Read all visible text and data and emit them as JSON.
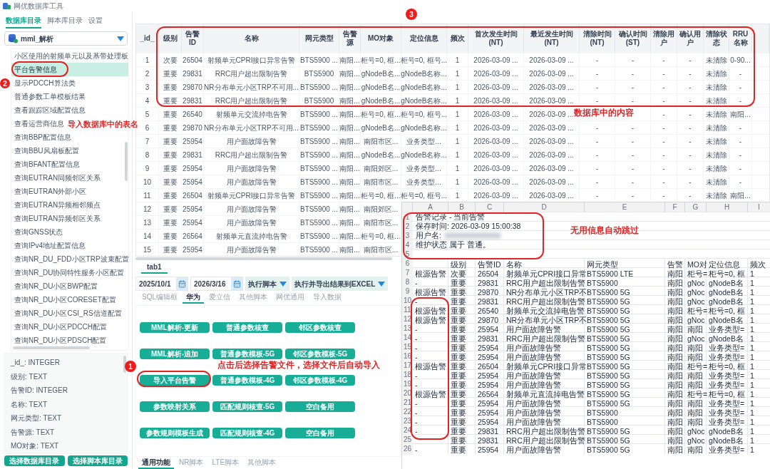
{
  "window": {
    "title": "网优数据库工具"
  },
  "sidebar": {
    "tabs": [
      {
        "label": "数据库目录",
        "selected": true
      },
      {
        "label": "脚本库目录",
        "selected": false
      },
      {
        "label": "设置",
        "selected": false
      }
    ],
    "database": "mml_解析",
    "tables": [
      {
        "label": "小区使用的射频单元以及基带处理板",
        "selected": false
      },
      {
        "label": "平台告警信息",
        "selected": true
      },
      {
        "label": "显示PDCCH算法类",
        "selected": false
      },
      {
        "label": "普通参数工单模板结果",
        "selected": false
      },
      {
        "label": "查看跟踪区域配置信息",
        "selected": false
      },
      {
        "label": "查看运营商信息",
        "selected": false
      },
      {
        "label": "查询BBP配置信息",
        "selected": false
      },
      {
        "label": "查询BBU风扇板配置",
        "selected": false
      },
      {
        "label": "查询BFANT配置信息",
        "selected": false
      },
      {
        "label": "查询EUTRAN同频邻区关系",
        "selected": false
      },
      {
        "label": "查询EUTRAN外部小区",
        "selected": false
      },
      {
        "label": "查询EUTRAN异频相邻频点",
        "selected": false
      },
      {
        "label": "查询EUTRAN异频邻区关系",
        "selected": false
      },
      {
        "label": "查询GNSS状态",
        "selected": false
      },
      {
        "label": "查询IPv4地址配置信息",
        "selected": false
      },
      {
        "label": "查询NR_DU_FDD小区TRP波束配置",
        "selected": false
      },
      {
        "label": "查询NR_DU协同特性服务小区配置",
        "selected": false
      },
      {
        "label": "查询NR_DU小区BWP配置",
        "selected": false
      },
      {
        "label": "查询NR_DU小区CORESET配置",
        "selected": false
      },
      {
        "label": "查询NR_DU小区CSI_RS信道配置",
        "selected": false
      },
      {
        "label": "查询NR_DU小区PDCCH配置",
        "selected": false
      },
      {
        "label": "查询NR_DU小区PDSCH配置",
        "selected": false
      }
    ],
    "fields": [
      "_id_: INTEGER",
      "级别: TEXT",
      "告警ID: INTEGER",
      "名称: TEXT",
      "网元类型: TEXT",
      "告警源: TEXT",
      "MO对象: TEXT"
    ],
    "buttons": [
      "选择数据库目录",
      "选择脚本库目录"
    ]
  },
  "table": {
    "columns": [
      "_id_",
      "级别",
      "告警ID",
      "名称",
      "网元类型",
      "告警源",
      "MO对象",
      "定位信息",
      "频次",
      "首次发生时间 (NT)",
      "最近发生时间 (NT)",
      "清除时间 (NT)",
      "确认时间 (ST)",
      "清除用户",
      "确认用户",
      "清除状态",
      "RRU名称"
    ],
    "rows": [
      [
        "1",
        "次要",
        "26504",
        "射频单元CPRI接口异常告警",
        "BTS5900 ...",
        "南阳...",
        "柜号=0, 框...",
        "柜号=0, 框号...",
        "1",
        "2026-03-09 ...",
        "2026-03-09 ...",
        "-",
        "-",
        "-",
        "-",
        "未清除",
        "0-90..."
      ],
      [
        "2",
        "重要",
        "29831",
        "RRC用户超出限制告警",
        "BTS5900",
        "南阳...",
        "gNodeB名...",
        "gNodeB名称...",
        "1",
        "2026-03-09 ...",
        "2026-03-09 ...",
        "-",
        "-",
        "-",
        "-",
        "未清除",
        "-"
      ],
      [
        "3",
        "重要",
        "29870",
        "NR分布单元小区TRP不可用...",
        "BTS5900 ...",
        "南阳...",
        "gNodeB名...",
        "gNodeB名称...",
        "1",
        "2026-03-09 ...",
        "2026-03-09 ...",
        "-",
        "-",
        "-",
        "-",
        "未清除",
        "-"
      ],
      [
        "4",
        "重要",
        "29831",
        "RRC用户超出限制告警",
        "BTS5900",
        "南阳...",
        "gNodeB名...",
        "gNodeB名称...",
        "1",
        "2026-03-09 ...",
        "2026-03-09 ...",
        "-",
        "-",
        "-",
        "-",
        "未清除",
        "-"
      ],
      [
        "5",
        "重要",
        "26540",
        "射频单元交流掉电告警",
        "BTS5900 ...",
        "南阳...",
        "柜号=0, 框...",
        "柜号=0, 框号...",
        "1",
        "2026-03-09 ...",
        "2026-03-09 ...",
        "",
        "",
        "-",
        "-",
        "未清除",
        "南阳..."
      ],
      [
        "6",
        "重要",
        "29870",
        "NR分布单元小区TRP不可用...",
        "BTS5900 ...",
        "南阳...",
        "gNodeB名...",
        "gNodeB名称...",
        "1",
        "2026-03-09 ...",
        "2026-03-09 ...",
        "-",
        "-",
        "-",
        "-",
        "未清除",
        "-"
      ],
      [
        "7",
        "重要",
        "25954",
        "用户面故障告警",
        "BTS5900 ...",
        "南阳...",
        "南阳市区...",
        "业务类型...",
        "1",
        "2026-03-09 ...",
        "2026-03-09 ...",
        "-",
        "-",
        "-",
        "-",
        "未清除",
        "-"
      ],
      [
        "8",
        "重要",
        "29831",
        "RRC用户超出限制告警",
        "BTS5900 ...",
        "南阳...",
        "gNodeB名...",
        "gNodeB名称...",
        "1",
        "2026-03-09 ...",
        "2026-03-09 ...",
        "-",
        "-",
        "-",
        "-",
        "未清除",
        "-"
      ],
      [
        "9",
        "重要",
        "25954",
        "用户面故障告警",
        "BTS5900 ...",
        "南阳...",
        "南阳郊区...",
        "业务类型...",
        "1",
        "2026-03-09 ...",
        "2026-03-09 ...",
        "-",
        "-",
        "-",
        "-",
        "未清除",
        "-"
      ],
      [
        "10",
        "重要",
        "25954",
        "用户面故障告警",
        "BTS5900 ...",
        "南阳...",
        "南阳市区...",
        "业务类型...",
        "1",
        "2026-03-09 ...",
        "2026-03-09 ...",
        "-",
        "-",
        "-",
        "-",
        "未清除",
        "-"
      ],
      [
        "11",
        "重要",
        "26504",
        "射频单元CPRI接口异常告警",
        "BTS5900 ...",
        "南阳...",
        "柜号=0, 框...",
        "柜号=0, 框号...",
        "1",
        "2026-03-09 ...",
        "2026-03-09 ...",
        "-",
        "-",
        "-",
        "-",
        "未清除",
        "南阳..."
      ],
      [
        "12",
        "重要",
        "25954",
        "用户面故障告警",
        "BTS5900 ...",
        "南阳...",
        "南阳郊区..."
      ],
      [
        "13",
        "重要",
        "25954",
        "用户面故障告警",
        "BTS5900 ...",
        "南阳...",
        "南阳市区..."
      ],
      [
        "14",
        "重要",
        "26564",
        "射频单元直流掉电告警",
        "BTS5900 ...",
        "南阳...",
        "柜号=0, 框..."
      ],
      [
        "15",
        "重要",
        "25954",
        "用户面故障告警",
        "BTS5900 ...",
        "南阳...",
        "南阳市区..."
      ]
    ]
  },
  "script_panel": {
    "tabs": [
      {
        "label": "tab1",
        "selected": true
      }
    ],
    "start_date": "2025/10/1",
    "end_date": "2026/3/16",
    "actions": [
      "执行脚本",
      "执行并导出结果到EXCEL"
    ],
    "vendor_tabs": [
      {
        "label": "SQL编辑框",
        "selected": false
      },
      {
        "label": "华为",
        "selected": true
      },
      {
        "label": "爱立信",
        "selected": false
      },
      {
        "label": "其他脚本",
        "selected": false
      },
      {
        "label": "网优通用",
        "selected": false
      },
      {
        "label": "导入数据",
        "selected": false
      }
    ],
    "buttons": [
      [
        "MML解析-更新",
        "普通参数核查",
        "邻区参数核查"
      ],
      [
        "MML解析-追加",
        "普通参数模板-5G",
        "邻区参数模板-5G"
      ],
      [
        "导入平台告警",
        "普通参数模板-4G",
        "邻区参数模板-4G"
      ],
      [
        "参数映射关系",
        "匹配规则核查-5G",
        "空白备用"
      ],
      [
        "参数规则模板生成",
        "匹配规则核查-4G",
        "空白备用"
      ]
    ],
    "bottom_tabs": [
      {
        "label": "通用功能",
        "selected": true
      },
      {
        "label": "NR脚本",
        "selected": false
      },
      {
        "label": "LTE脚本",
        "selected": false
      },
      {
        "label": "其他脚本",
        "selected": false
      }
    ]
  },
  "spreadsheet": {
    "columns": [
      "A",
      "B",
      "C",
      "D",
      "E",
      "F",
      "G",
      "H",
      "I"
    ],
    "info_rows": [
      {
        "number": "1",
        "text": "告警记录 - 当前告警"
      },
      {
        "number": "2",
        "text": "保存时间:  2026-03-09 15:00:38"
      },
      {
        "number": "3",
        "text": "用户名:",
        "redacted": true
      },
      {
        "number": "4",
        "text": "维护状态 属于 普通。"
      },
      {
        "number": "5"
      }
    ],
    "rows": [
      {
        "number": "6",
        "cells": [
          "",
          "级别",
          "告警ID",
          "名称",
          "网元类型",
          "告警",
          "MO对",
          "定位信息",
          "频次"
        ]
      },
      {
        "number": "7",
        "cells": [
          "根源告警",
          "次要",
          "26504",
          "射频单元CPRI接口异常",
          "BTS5900 LTE",
          "南阳",
          "柜号=",
          "柜号=0, 框",
          "1"
        ]
      },
      {
        "number": "8",
        "cells": [
          "-",
          "重要",
          "29831",
          "RRC用户超出限制告警",
          "BTS5900",
          "南阳",
          "gNoc",
          "gNodeB名",
          "1"
        ]
      },
      {
        "number": "9",
        "cells": [
          "根源告警",
          "重要",
          "29870",
          "NR分布单元小区TRP不",
          "BTS5900 5G",
          "南阳",
          "gNoc",
          "gNodeB名",
          "1"
        ]
      },
      {
        "number": "10",
        "cells": [
          "-",
          "重要",
          "29831",
          "RRC用户超出限制告警",
          "BTS5900 5G",
          "南阳",
          "gNoc",
          "gNodeB名",
          "1"
        ]
      },
      {
        "number": "11",
        "cells": [
          "根源告警",
          "重要",
          "26540",
          "射频单元交流掉电告警",
          "BTS5900 5G",
          "南阳",
          "柜号=",
          "柜号=0, 框",
          "1"
        ]
      },
      {
        "number": "12",
        "cells": [
          "根源告警",
          "重要",
          "29870",
          "NR分布单元小区TRP不",
          "BTS5900 5G",
          "南阳",
          "gNoc",
          "gNodeB名",
          "1"
        ]
      },
      {
        "number": "13",
        "cells": [
          "-",
          "重要",
          "25954",
          "用户面故障告警",
          "BTS5900 5G",
          "南阳",
          "南阳",
          "业务类型=",
          "1"
        ]
      },
      {
        "number": "14",
        "cells": [
          "-",
          "重要",
          "29831",
          "RRC用户超出限制告警",
          "BTS5900 5G",
          "南阳",
          "gNoc",
          "gNodeB名",
          "1"
        ]
      },
      {
        "number": "15",
        "cells": [
          "-",
          "重要",
          "25954",
          "用户面故障告警",
          "BTS5900 5G",
          "南阳",
          "南阳",
          "业务类型=",
          "1"
        ]
      },
      {
        "number": "16",
        "cells": [
          "-",
          "重要",
          "25954",
          "用户面故障告警",
          "BTS5900 5G",
          "南阳",
          "南阳",
          "业务类型=",
          "1"
        ]
      },
      {
        "number": "17",
        "cells": [
          "根源告警",
          "重要",
          "26504",
          "射频单元CPRI接口异常",
          "BTS5900 5G",
          "南阳",
          "柜号=",
          "柜号=0, 框",
          "1"
        ]
      },
      {
        "number": "18",
        "cells": [
          "-",
          "重要",
          "25954",
          "用户面故障告警",
          "BTS5900 5G",
          "南阳",
          "南阳",
          "业务类型=",
          "1"
        ]
      },
      {
        "number": "19",
        "cells": [
          "-",
          "重要",
          "25954",
          "用户面故障告警",
          "BTS5900 5G",
          "南阳",
          "南阳",
          "业务类型=",
          "1"
        ]
      },
      {
        "number": "20",
        "cells": [
          "根源告警",
          "重要",
          "26564",
          "射频单元直流掉电告警",
          "BTS5900 5G",
          "南阳",
          "柜号=",
          "柜号=0, 框",
          "1"
        ]
      },
      {
        "number": "21",
        "cells": [
          "-",
          "重要",
          "25954",
          "用户面故障告警",
          "BTS5900 5G",
          "南阳",
          "南阳",
          "业务类型=",
          "1"
        ]
      },
      {
        "number": "22",
        "cells": [
          "-",
          "重要",
          "25954",
          "用户面故障告警",
          "BTS5900",
          "南阳",
          "南阳",
          "业务类型=",
          "1"
        ]
      },
      {
        "number": "23",
        "cells": [
          "-",
          "重要",
          "25954",
          "用户面故障告警",
          "BTS5900",
          "南阳",
          "南阳",
          "业务类型=",
          "1"
        ]
      },
      {
        "number": "24",
        "cells": [
          "-",
          "重要",
          "29831",
          "RRC用户超出限制告警",
          "BTS5900 5G",
          "南阳",
          "gNoc",
          "gNodeB名",
          "1"
        ]
      },
      {
        "number": "25",
        "cells": [
          "",
          "重要",
          "29831",
          "RRC用户超出限制告警",
          "BTS5900 5G",
          "南阳",
          "gNoc",
          "gNodeB名",
          "1"
        ]
      },
      {
        "number": "26",
        "cells": [
          "-",
          "重要",
          "25954",
          "用户面故障告警",
          "BTS5900 5G",
          "南阳",
          "南阳",
          "业务类型=",
          "1"
        ]
      }
    ]
  },
  "annotations": {
    "markers": [
      "1",
      "2",
      "3"
    ],
    "notes": [
      "导入数据库中的表名",
      "数据库中的内容",
      "点击后选择告警文件，选择文件后自动导入",
      "无用信息自动跳过"
    ]
  }
}
